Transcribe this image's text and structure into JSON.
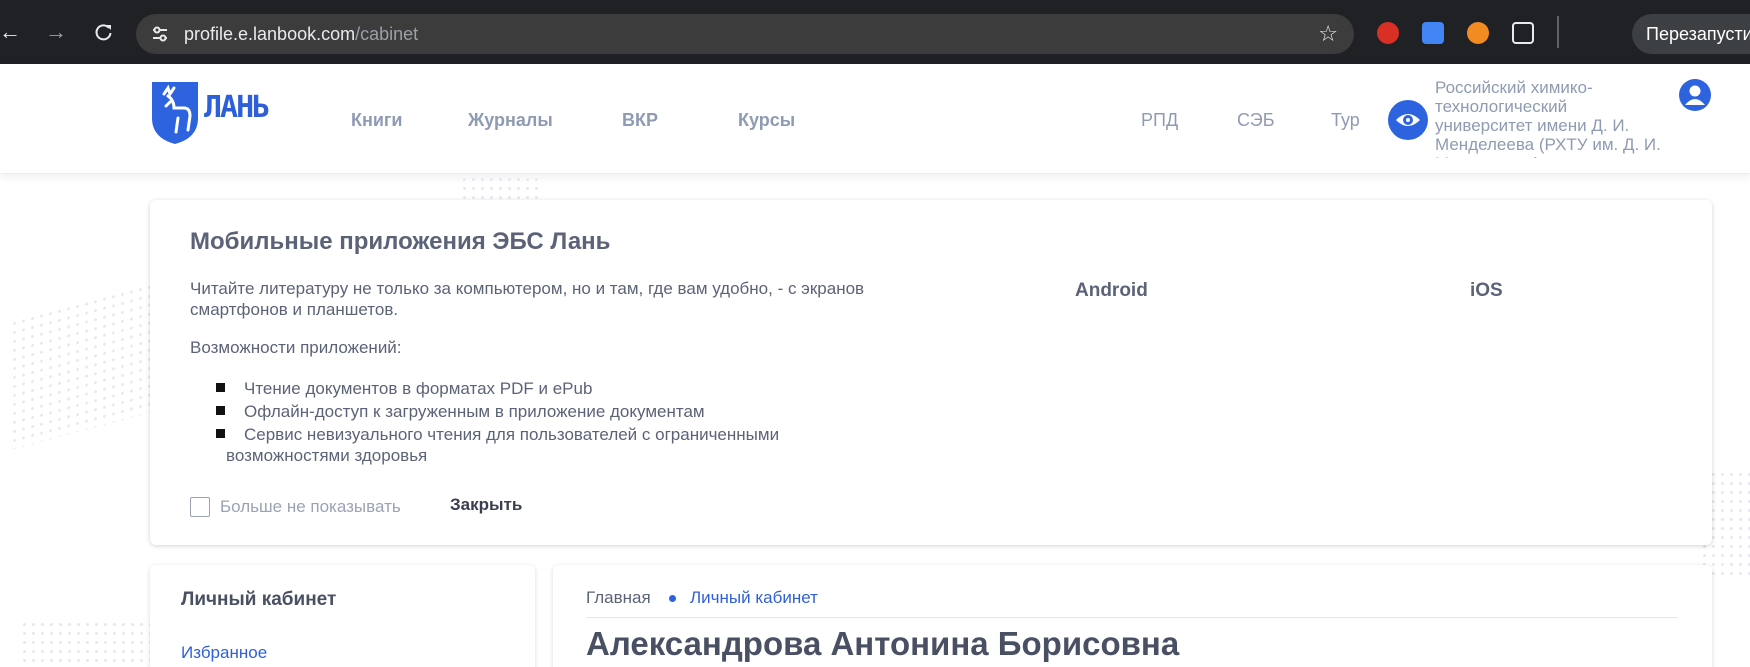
{
  "browser": {
    "url_host": "profile.e.lanbook.com",
    "url_path": "/cabinet",
    "restart_label": "Перезапустить"
  },
  "header": {
    "logo_text": "ЛАНЬ",
    "nav": [
      {
        "label": "Книги"
      },
      {
        "label": "Журналы"
      },
      {
        "label": "ВКР"
      },
      {
        "label": "Курсы"
      }
    ],
    "right_nav": [
      {
        "label": "РПД"
      },
      {
        "label": "СЭБ"
      },
      {
        "label": "Тур"
      }
    ],
    "organization": "Российский химико-технологический университет имени Д. И. Менделеева (РХТУ им. Д. И. Менделеева)"
  },
  "apps_card": {
    "title": "Мобильные приложения ЭБС Лань",
    "description": "Читайте литературу не только за компьютером, но и там, где вам удобно, - с экранов смартфонов и планшетов.",
    "features_label": "Возможности приложений:",
    "features": [
      "Чтение документов в форматах PDF и ePub",
      "Офлайн-доступ к загруженным в приложение документам",
      "Сервис невизуального чтения для пользователей с ограниченными",
      "возможностями здоровья"
    ],
    "android_label": "Android",
    "ios_label": "iOS",
    "dont_show_label": "Больше не показывать",
    "close_label": "Закрыть",
    "dont_show_checked": false
  },
  "sidebar": {
    "title": "Личный кабинет",
    "links": [
      {
        "label": "Избранное"
      }
    ]
  },
  "main": {
    "breadcrumb": {
      "home": "Главная",
      "current": "Личный кабинет"
    },
    "user_name": "Александрова Антонина Борисовна"
  },
  "colors": {
    "accent": "#2e63e0",
    "text": "#5c6378",
    "muted": "#8f9bb3"
  }
}
